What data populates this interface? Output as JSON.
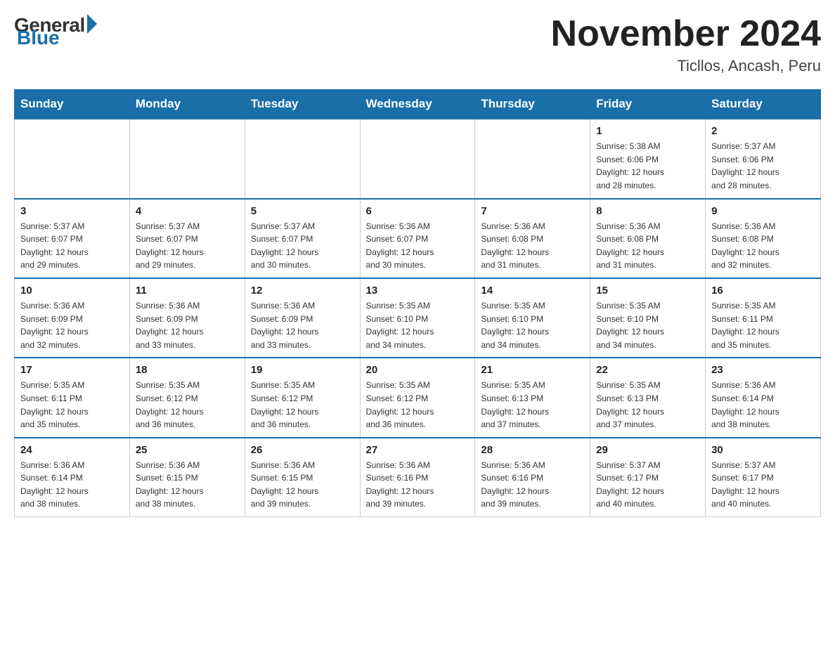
{
  "header": {
    "logo": {
      "general": "General",
      "blue": "Blue"
    },
    "title": "November 2024",
    "subtitle": "Ticllos, Ancash, Peru"
  },
  "weekdays": [
    "Sunday",
    "Monday",
    "Tuesday",
    "Wednesday",
    "Thursday",
    "Friday",
    "Saturday"
  ],
  "weeks": [
    [
      {
        "day": "",
        "info": ""
      },
      {
        "day": "",
        "info": ""
      },
      {
        "day": "",
        "info": ""
      },
      {
        "day": "",
        "info": ""
      },
      {
        "day": "",
        "info": ""
      },
      {
        "day": "1",
        "info": "Sunrise: 5:38 AM\nSunset: 6:06 PM\nDaylight: 12 hours\nand 28 minutes."
      },
      {
        "day": "2",
        "info": "Sunrise: 5:37 AM\nSunset: 6:06 PM\nDaylight: 12 hours\nand 28 minutes."
      }
    ],
    [
      {
        "day": "3",
        "info": "Sunrise: 5:37 AM\nSunset: 6:07 PM\nDaylight: 12 hours\nand 29 minutes."
      },
      {
        "day": "4",
        "info": "Sunrise: 5:37 AM\nSunset: 6:07 PM\nDaylight: 12 hours\nand 29 minutes."
      },
      {
        "day": "5",
        "info": "Sunrise: 5:37 AM\nSunset: 6:07 PM\nDaylight: 12 hours\nand 30 minutes."
      },
      {
        "day": "6",
        "info": "Sunrise: 5:36 AM\nSunset: 6:07 PM\nDaylight: 12 hours\nand 30 minutes."
      },
      {
        "day": "7",
        "info": "Sunrise: 5:36 AM\nSunset: 6:08 PM\nDaylight: 12 hours\nand 31 minutes."
      },
      {
        "day": "8",
        "info": "Sunrise: 5:36 AM\nSunset: 6:08 PM\nDaylight: 12 hours\nand 31 minutes."
      },
      {
        "day": "9",
        "info": "Sunrise: 5:36 AM\nSunset: 6:08 PM\nDaylight: 12 hours\nand 32 minutes."
      }
    ],
    [
      {
        "day": "10",
        "info": "Sunrise: 5:36 AM\nSunset: 6:09 PM\nDaylight: 12 hours\nand 32 minutes."
      },
      {
        "day": "11",
        "info": "Sunrise: 5:36 AM\nSunset: 6:09 PM\nDaylight: 12 hours\nand 33 minutes."
      },
      {
        "day": "12",
        "info": "Sunrise: 5:36 AM\nSunset: 6:09 PM\nDaylight: 12 hours\nand 33 minutes."
      },
      {
        "day": "13",
        "info": "Sunrise: 5:35 AM\nSunset: 6:10 PM\nDaylight: 12 hours\nand 34 minutes."
      },
      {
        "day": "14",
        "info": "Sunrise: 5:35 AM\nSunset: 6:10 PM\nDaylight: 12 hours\nand 34 minutes."
      },
      {
        "day": "15",
        "info": "Sunrise: 5:35 AM\nSunset: 6:10 PM\nDaylight: 12 hours\nand 34 minutes."
      },
      {
        "day": "16",
        "info": "Sunrise: 5:35 AM\nSunset: 6:11 PM\nDaylight: 12 hours\nand 35 minutes."
      }
    ],
    [
      {
        "day": "17",
        "info": "Sunrise: 5:35 AM\nSunset: 6:11 PM\nDaylight: 12 hours\nand 35 minutes."
      },
      {
        "day": "18",
        "info": "Sunrise: 5:35 AM\nSunset: 6:12 PM\nDaylight: 12 hours\nand 36 minutes."
      },
      {
        "day": "19",
        "info": "Sunrise: 5:35 AM\nSunset: 6:12 PM\nDaylight: 12 hours\nand 36 minutes."
      },
      {
        "day": "20",
        "info": "Sunrise: 5:35 AM\nSunset: 6:12 PM\nDaylight: 12 hours\nand 36 minutes."
      },
      {
        "day": "21",
        "info": "Sunrise: 5:35 AM\nSunset: 6:13 PM\nDaylight: 12 hours\nand 37 minutes."
      },
      {
        "day": "22",
        "info": "Sunrise: 5:35 AM\nSunset: 6:13 PM\nDaylight: 12 hours\nand 37 minutes."
      },
      {
        "day": "23",
        "info": "Sunrise: 5:36 AM\nSunset: 6:14 PM\nDaylight: 12 hours\nand 38 minutes."
      }
    ],
    [
      {
        "day": "24",
        "info": "Sunrise: 5:36 AM\nSunset: 6:14 PM\nDaylight: 12 hours\nand 38 minutes."
      },
      {
        "day": "25",
        "info": "Sunrise: 5:36 AM\nSunset: 6:15 PM\nDaylight: 12 hours\nand 38 minutes."
      },
      {
        "day": "26",
        "info": "Sunrise: 5:36 AM\nSunset: 6:15 PM\nDaylight: 12 hours\nand 39 minutes."
      },
      {
        "day": "27",
        "info": "Sunrise: 5:36 AM\nSunset: 6:16 PM\nDaylight: 12 hours\nand 39 minutes."
      },
      {
        "day": "28",
        "info": "Sunrise: 5:36 AM\nSunset: 6:16 PM\nDaylight: 12 hours\nand 39 minutes."
      },
      {
        "day": "29",
        "info": "Sunrise: 5:37 AM\nSunset: 6:17 PM\nDaylight: 12 hours\nand 40 minutes."
      },
      {
        "day": "30",
        "info": "Sunrise: 5:37 AM\nSunset: 6:17 PM\nDaylight: 12 hours\nand 40 minutes."
      }
    ]
  ]
}
